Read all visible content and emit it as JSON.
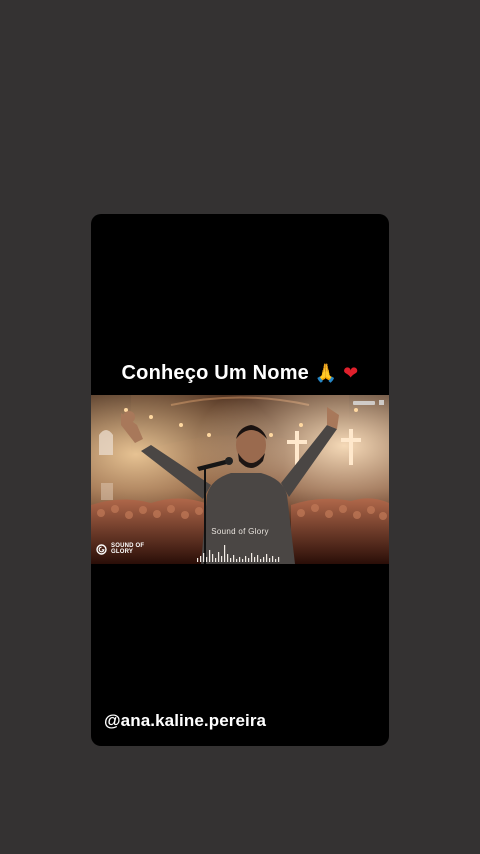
{
  "story": {
    "caption": "Conheço Um Nome",
    "emoji_praying": "🙏",
    "emoji_heart": "❤",
    "username": "@ana.kaline.pereira"
  },
  "media": {
    "soundtrack_label": "Sound of Glory",
    "brand_line1": "SOUND OF",
    "brand_line2": "GLORY"
  },
  "colors": {
    "page_background": "#343232",
    "card_background": "#000000",
    "stage_light": "#f0c08a",
    "crowd": "#3a1a10"
  }
}
